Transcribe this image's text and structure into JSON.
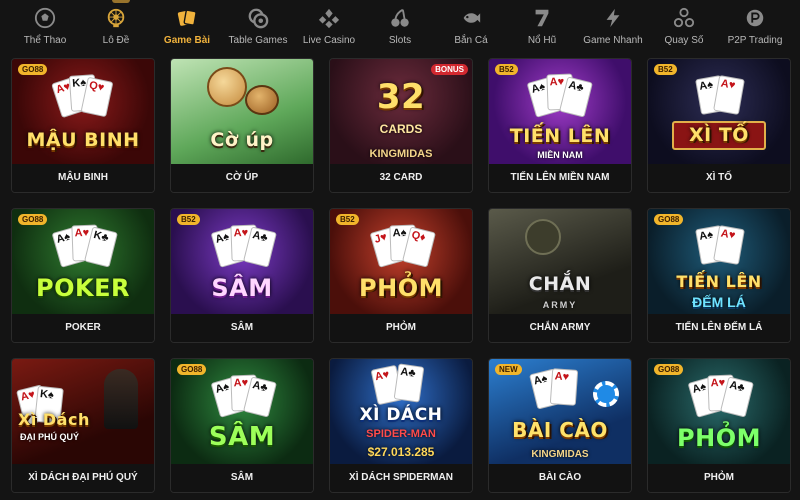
{
  "nav": {
    "items": [
      {
        "label": "Thể Thao",
        "icon": "soccer-ball-icon"
      },
      {
        "label": "Lô Đề",
        "icon": "lottery-wheel-icon"
      },
      {
        "label": "Game Bài",
        "icon": "playing-cards-icon"
      },
      {
        "label": "Table Games",
        "icon": "chips-icon"
      },
      {
        "label": "Live Casino",
        "icon": "card-suits-icon"
      },
      {
        "label": "Slots",
        "icon": "cherries-icon"
      },
      {
        "label": "Bắn Cá",
        "icon": "fish-icon"
      },
      {
        "label": "Nổ Hũ",
        "icon": "lucky-seven-icon"
      },
      {
        "label": "Game Nhanh",
        "icon": "lightning-icon"
      },
      {
        "label": "Quay Số",
        "icon": "lottery-balls-icon"
      },
      {
        "label": "P2P Trading",
        "icon": "p2p-trading-icon"
      }
    ],
    "active_label": "Game Bài",
    "active_color": "#f0b23c"
  },
  "games": [
    {
      "label": "MẬU BINH",
      "art_title": "MẬU BINH",
      "tag": "GO88"
    },
    {
      "label": "CỜ ÚP",
      "art_title": "Cờ úp",
      "tag": ""
    },
    {
      "label": "32 CARD",
      "art_title": "32",
      "art_sub": "CARDS",
      "art_brand": "KINGMIDAS",
      "tag": "BONUS"
    },
    {
      "label": "TIẾN LÊN MIỀN NAM",
      "art_title": "TIẾN LÊN",
      "art_sub": "MIỀN NAM",
      "tag": "B52"
    },
    {
      "label": "XÌ TỐ",
      "art_title": "XÌ TỐ",
      "tag": "B52"
    },
    {
      "label": "POKER",
      "art_title": "POKER",
      "tag": "GO88"
    },
    {
      "label": "SÂM",
      "art_title": "SÂM",
      "tag": "B52"
    },
    {
      "label": "PHỎM",
      "art_title": "PHỎM",
      "tag": "B52"
    },
    {
      "label": "CHẮN ARMY",
      "art_title": "CHẮN",
      "art_sub": "ARMY",
      "tag": ""
    },
    {
      "label": "TIẾN LÊN ĐẾM LÁ",
      "art_title": "TIẾN LÊN",
      "art_sub": "ĐẾM LÁ",
      "tag": "GO88"
    },
    {
      "label": "XÌ DÁCH ĐẠI PHÚ QUÝ",
      "art_title": "Xì Dách",
      "art_sub": "ĐẠI PHÚ QUÝ",
      "tag": ""
    },
    {
      "label": "SÂM",
      "art_title": "SÂM",
      "tag": "GO88"
    },
    {
      "label": "XÌ DÁCH SPIDERMAN",
      "art_title": "XÌ DÁCH",
      "art_sub": "SPIDER-MAN",
      "art_jackpot": "$27.013.285",
      "tag": ""
    },
    {
      "label": "BÀI CÀO",
      "art_title": "BÀI CÀO",
      "art_brand": "KINGMIDAS",
      "tag": "NEW"
    },
    {
      "label": "PHỎM",
      "art_title": "PHỎM",
      "tag": "GO88"
    }
  ]
}
